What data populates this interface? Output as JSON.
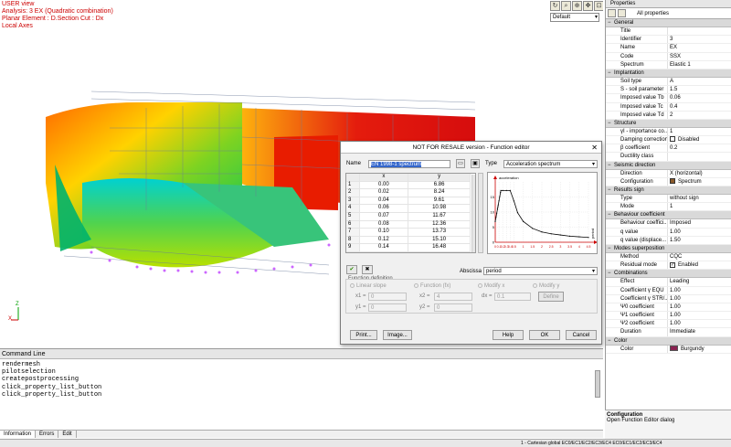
{
  "viewport": {
    "lines": [
      "USER view",
      "Analysis: 3 EX (Quadratic combination)",
      "Planar Element : D.Section Cut : Dx",
      "Local Axes"
    ],
    "display_combo": "Default",
    "axis_x": "X",
    "axis_z": "Z"
  },
  "command_line": {
    "title": "Command Line",
    "lines": [
      "rendermesh",
      "pilotselection",
      "createpostprocessing",
      "click_property_list_button",
      "click_property_list_button"
    ]
  },
  "bottom_tabs": [
    "Information",
    "Errors",
    "Edit"
  ],
  "status_bar": "1 - Cartesian global   EC0/EC1/EC2/EC3/EC4   EC0/EC1/EC2/EC3/EC4",
  "properties": {
    "title": "Properties",
    "filter": "All properties",
    "sections": [
      {
        "name": "General",
        "rows": [
          {
            "label": "Title",
            "value": ""
          },
          {
            "label": "Identifier",
            "value": "3"
          },
          {
            "label": "Name",
            "value": "EX"
          },
          {
            "label": "Code",
            "value": "SSX"
          },
          {
            "label": "Spectrum",
            "value": "Elastic 1"
          }
        ]
      },
      {
        "name": "Implantation",
        "rows": [
          {
            "label": "Soil type",
            "value": "A"
          },
          {
            "label": "S - soil parameter",
            "value": "1.5"
          },
          {
            "label": "Imposed value Tb",
            "value": "0.06"
          },
          {
            "label": "Imposed value Tc",
            "value": "0.4"
          },
          {
            "label": "Imposed value Td",
            "value": "2"
          }
        ]
      },
      {
        "name": "Structure",
        "rows": [
          {
            "label": "γI - importance co...",
            "value": "1"
          },
          {
            "label": "Damping correction",
            "value": "Disabled",
            "check": true
          },
          {
            "label": "β coefficient",
            "value": "0.2"
          },
          {
            "label": "Ductility class",
            "value": ""
          }
        ]
      },
      {
        "name": "Seismic direction",
        "rows": [
          {
            "label": "Direction",
            "value": "X (horizontal)"
          },
          {
            "label": "Configuration",
            "value": "Spectrum",
            "icon": true
          }
        ]
      },
      {
        "name": "Results sign",
        "rows": [
          {
            "label": "Type",
            "value": "without sign"
          },
          {
            "label": "Mode",
            "value": "1"
          }
        ]
      },
      {
        "name": "Behaviour coefficient",
        "rows": [
          {
            "label": "Behaviour coeffici...",
            "value": "Imposed"
          },
          {
            "label": "q value",
            "value": "1.00"
          },
          {
            "label": "q value (displace...",
            "value": "1.50"
          }
        ]
      },
      {
        "name": "Modes superposition",
        "rows": [
          {
            "label": "Method",
            "value": "CQC"
          },
          {
            "label": "Residual mode",
            "value": "Enabled",
            "check": true,
            "checked": true
          }
        ]
      },
      {
        "name": "Combinations",
        "rows": [
          {
            "label": "Effect",
            "value": "Leading"
          },
          {
            "label": "Coefficient γ EQU",
            "value": "1.00"
          },
          {
            "label": "Coefficient γ STR/...",
            "value": "1.00"
          },
          {
            "label": "Ψ0 coefficient",
            "value": "1.00"
          },
          {
            "label": "Ψ1 coefficient",
            "value": "1.00"
          },
          {
            "label": "Ψ2 coefficient",
            "value": "1.00"
          },
          {
            "label": "Duration",
            "value": "Immediate"
          }
        ]
      },
      {
        "name": "Color",
        "rows": [
          {
            "label": "Color",
            "value": "Burgundy",
            "swatch": true
          }
        ]
      }
    ],
    "description_title": "Configuration",
    "description_text": "Open Function Editor dialog"
  },
  "dialog": {
    "title": "NOT FOR RESALE version - Function editor",
    "name_label": "Name",
    "name_value": "EN 1998-1 spectrum",
    "type_label": "Type",
    "type_value": "Acceleration spectrum",
    "table": {
      "headers": [
        "x",
        "y"
      ],
      "rows": [
        [
          "1",
          "0.00",
          "6.86"
        ],
        [
          "2",
          "0.02",
          "8.24"
        ],
        [
          "3",
          "0.04",
          "9.61"
        ],
        [
          "4",
          "0.06",
          "10.98"
        ],
        [
          "5",
          "0.07",
          "11.67"
        ],
        [
          "6",
          "0.08",
          "12.36"
        ],
        [
          "7",
          "0.10",
          "13.73"
        ],
        [
          "8",
          "0.12",
          "15.10"
        ],
        [
          "9",
          "0.14",
          "16.48"
        ],
        [
          "10",
          "0.15",
          "17.16"
        ]
      ]
    },
    "abscissa_label": "Abscissa",
    "abscissa_value": "period",
    "funcdef_label": "Function definition",
    "radio_linear": "Linear slope",
    "radio_function": "Function (fx)",
    "radio_modify_x": "Modify x",
    "radio_modify_y": "Modify y",
    "x1_label": "x1 =",
    "x1_value": "0",
    "x2_label": "x2 =",
    "x2_value": "4",
    "dx_label": "dx =",
    "dx_value": "0.1",
    "y1_label": "y1 =",
    "y1_value": "0",
    "y2_label": "y2 =",
    "y2_value": "0",
    "define_label": "Define",
    "print_label": "Print...",
    "image_label": "Image...",
    "help_label": "Help",
    "ok_label": "OK",
    "cancel_label": "Cancel",
    "close_glyph": "✕"
  },
  "chart_data": {
    "type": "line",
    "ylabel": "acceleration",
    "xlabel": "period",
    "x_ticks": [
      "0",
      "0.1",
      "0.2",
      "0.3",
      "0.4",
      "0.5",
      "1",
      "1.5",
      "2",
      "2.5",
      "3",
      "3.5",
      "4",
      "4.5"
    ],
    "y_ticks": [
      "0",
      "5",
      "10",
      "15"
    ],
    "xlim": [
      0,
      4.5
    ],
    "ylim": [
      0,
      20
    ],
    "series": [
      {
        "x": [
          0,
          0.02,
          0.04,
          0.06,
          0.07,
          0.08,
          0.1,
          0.12,
          0.14,
          0.15,
          0.2,
          0.3,
          0.4,
          0.5,
          0.7,
          1,
          1.5,
          2,
          2.5,
          3,
          3.5,
          4,
          4.5
        ],
        "y": [
          6.86,
          8.24,
          9.61,
          10.98,
          11.67,
          12.36,
          13.73,
          15.1,
          16.48,
          17.16,
          17.16,
          17.16,
          17.16,
          13.7,
          9.8,
          6.9,
          4.6,
          3.4,
          2.8,
          2.4,
          2.0,
          1.8,
          1.6
        ]
      }
    ]
  }
}
